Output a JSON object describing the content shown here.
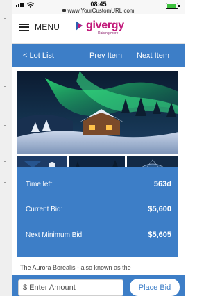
{
  "status_bar": {
    "time": "08:45",
    "url": "www.YourCustomURL.com"
  },
  "header": {
    "menu_label": "MENU",
    "logo_text": "givergy",
    "logo_tagline": "Raising more",
    "brand_color": "#c2187a"
  },
  "nav": {
    "lot_list": "< Lot List",
    "prev_item": "Prev Item",
    "next_item": "Next Item"
  },
  "bid_info": {
    "time_left_label": "Time left:",
    "time_left_value": "563d",
    "current_bid_label": "Current Bid:",
    "current_bid_value": "$5,600",
    "next_min_label": "Next Minimum Bid:",
    "next_min_value": "$5,605"
  },
  "description_snippet": "The Aurora Borealis - also known as the",
  "bid_form": {
    "amount_placeholder": "$ Enter Amount",
    "place_bid_label": "Place Bid"
  },
  "colors": {
    "primary_blue": "#3d7ec7",
    "accent_magenta": "#c2187a"
  }
}
